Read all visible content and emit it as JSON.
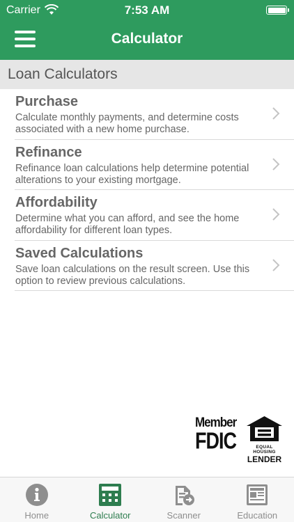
{
  "status_bar": {
    "carrier": "Carrier",
    "time": "7:53 AM"
  },
  "nav": {
    "title": "Calculator"
  },
  "section": {
    "title": "Loan Calculators"
  },
  "items": [
    {
      "title": "Purchase",
      "description": "Calculate monthly payments, and determine costs associated with a new home purchase."
    },
    {
      "title": "Refinance",
      "description": "Refinance loan calculations help determine potential alterations to your existing mortgage."
    },
    {
      "title": "Affordability",
      "description": "Determine what you can afford, and see the home affordability for different loan types."
    },
    {
      "title": "Saved Calculations",
      "description": "Save loan calculations on the result screen. Use this option to review previous calculations."
    }
  ],
  "logos": {
    "fdic_member": "Member",
    "fdic_name": "FDIC",
    "ehl_line1": "EQUAL HOUSING",
    "ehl_line2": "LENDER"
  },
  "tabs": [
    {
      "label": "Home",
      "icon": "info-icon"
    },
    {
      "label": "Calculator",
      "icon": "calculator-icon",
      "active": true
    },
    {
      "label": "Scanner",
      "icon": "scanner-icon"
    },
    {
      "label": "Education",
      "icon": "newspaper-icon"
    }
  ],
  "colors": {
    "brand_green": "#2e9b5e",
    "active_tab": "#2e7d4f",
    "inactive_tab": "#8e8e8e"
  }
}
